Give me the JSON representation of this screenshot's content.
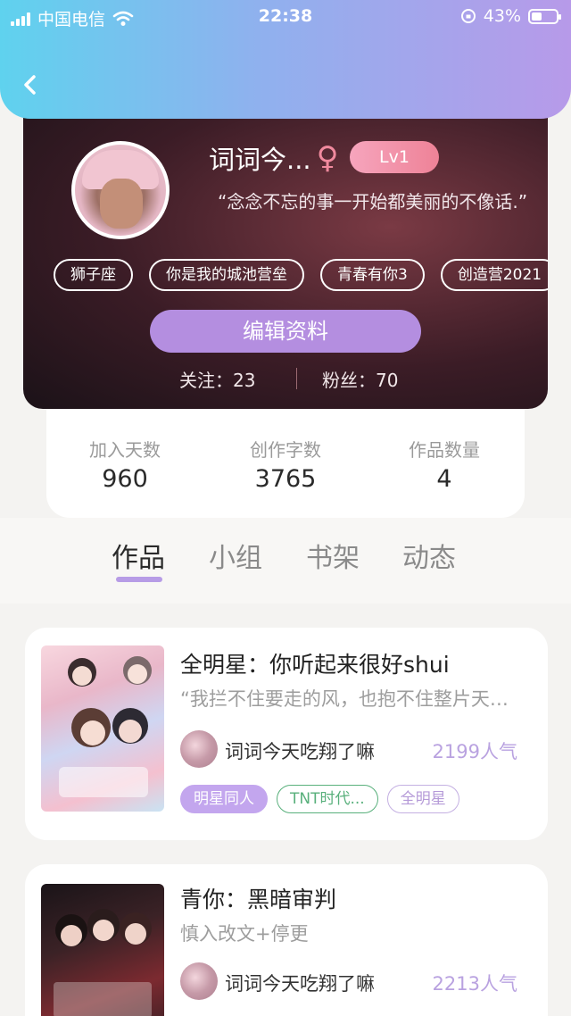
{
  "status_bar": {
    "carrier": "中国电信",
    "time": "22:38",
    "battery": "43%"
  },
  "profile": {
    "name": "词词今...",
    "gender_symbol": "♀",
    "level": "Lv1",
    "motto": "“念念不忘的事一开始都美丽的不像话.”",
    "tags": [
      "狮子座",
      "你是我的城池营垒",
      "青春有你3",
      "创造营2021"
    ],
    "edit_label": "编辑资料",
    "following": "关注：23",
    "followers": "粉丝：70"
  },
  "stats": [
    {
      "label": "加入天数",
      "value": "960"
    },
    {
      "label": "创作字数",
      "value": "3765"
    },
    {
      "label": "作品数量",
      "value": "4"
    }
  ],
  "tabs": [
    "作品",
    "小组",
    "书架",
    "动态"
  ],
  "works": [
    {
      "title": "全明星：你听起来很好shui",
      "desc": "“我拦不住要走的风，也抱不住整片天…",
      "author": "词词今天吃翔了嘛",
      "popularity": "2199人气",
      "tags": [
        "明星同人",
        "TNT时代...",
        "全明星"
      ]
    },
    {
      "title": "青你：黑暗审判",
      "desc": "慎入改文+停更",
      "author": "词词今天吃翔了嘛",
      "popularity": "2213人气"
    }
  ]
}
